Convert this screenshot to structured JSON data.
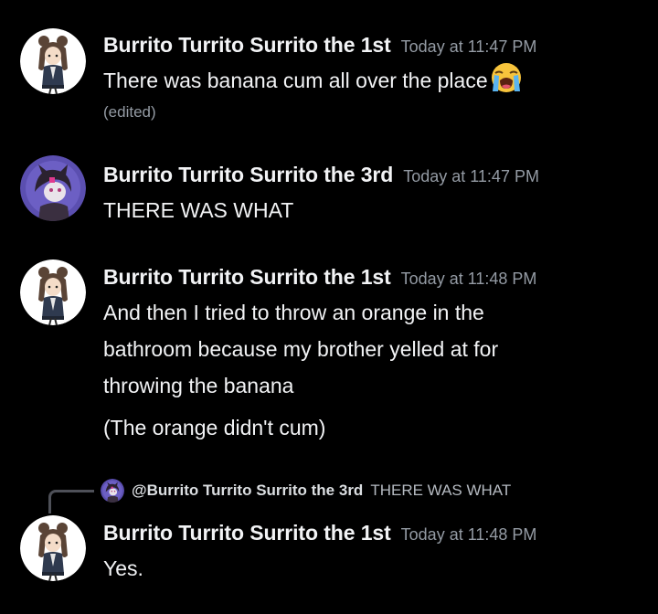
{
  "messages": [
    {
      "author": "Burrito Turrito Surrito the 1st",
      "timestamp": "Today at 11:47 PM",
      "text": "There was banana cum all over the place",
      "emoji": "loudly-crying-face",
      "edited": "(edited)"
    },
    {
      "author": "Burrito Turrito Surrito the 3rd",
      "timestamp": "Today at 11:47 PM",
      "text": "THERE WAS WHAT"
    },
    {
      "author": "Burrito Turrito Surrito the 1st",
      "timestamp": "Today at 11:48 PM",
      "text_lines": [
        "And then I tried to throw an orange in the",
        "bathroom because my brother yelled at for",
        "throwing the banana"
      ],
      "text2": "(The orange didn't cum)"
    },
    {
      "reply": {
        "mention": "@Burrito Turrito Surrito the 3rd",
        "snippet": "THERE WAS WHAT"
      },
      "author": "Burrito Turrito Surrito the 1st",
      "timestamp": "Today at 11:48 PM",
      "text": "Yes."
    }
  ],
  "colors": {
    "background": "#000000",
    "author": "#f2f3f5",
    "timestamp": "#949ba4",
    "body_text": "#f2f3f5",
    "reply_line": "#4e5058",
    "avatar_purple": "#5b4fb0"
  }
}
